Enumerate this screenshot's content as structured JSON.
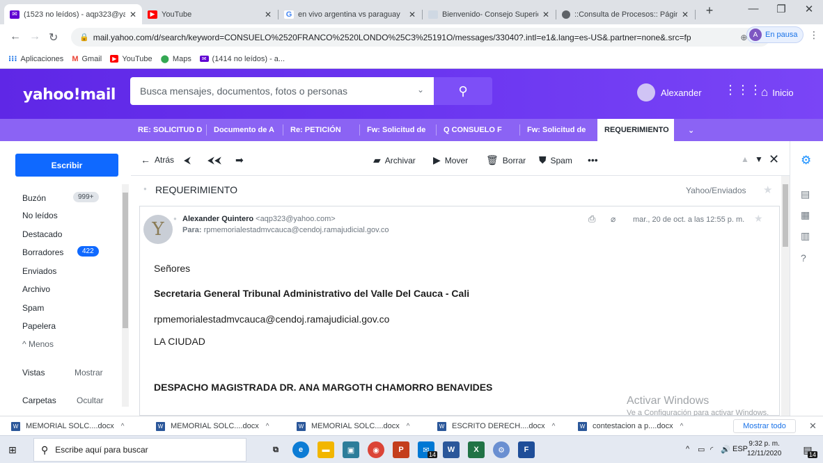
{
  "browser": {
    "tabs": [
      {
        "label": "(1523 no leídos) - aqp323@ya",
        "icon": "yahoo-mail-icon",
        "active": true
      },
      {
        "label": "YouTube",
        "icon": "youtube-icon",
        "active": false
      },
      {
        "label": "en vivo argentina vs paraguay",
        "icon": "google-icon",
        "active": false
      },
      {
        "label": "Bienvenido- Consejo Superior",
        "icon": "page-icon",
        "active": false
      },
      {
        "label": "::Consulta de Procesos:: Págin",
        "icon": "globe-icon",
        "active": false
      }
    ],
    "url": "mail.yahoo.com/d/search/keyword=CONSUELO%2520FRANCO%2520LONDO%25C3%25191O/messages/33040?.intl=e1&.lang=es-US&.partner=none&.src=fp",
    "profile_initial": "A",
    "profile_label": "En pausa",
    "bookmarks": [
      {
        "label": "Aplicaciones",
        "icon": "apps-grid-icon"
      },
      {
        "label": "Gmail",
        "icon": "gmail-icon"
      },
      {
        "label": "YouTube",
        "icon": "youtube-icon"
      },
      {
        "label": "Maps",
        "icon": "maps-pin-icon"
      },
      {
        "label": "(1414 no leídos) - a...",
        "icon": "yahoo-mail-icon"
      }
    ]
  },
  "yahoo": {
    "logo": "yahoo!mail",
    "search_placeholder": "Busca mensajes, documentos, fotos o personas",
    "user_name": "Alexander",
    "home_label": "Inicio",
    "mail_tabs": [
      {
        "label": "RE: SOLICITUD D",
        "active": false
      },
      {
        "label": "Documento de A",
        "active": false
      },
      {
        "label": "Re: PETICIÓN",
        "active": false
      },
      {
        "label": "Fw: Solicitud de",
        "active": false
      },
      {
        "label": "Q  CONSUELO F",
        "active": false
      },
      {
        "label": "Fw: Solicitud de",
        "active": false
      },
      {
        "label": "REQUERIMIENTO",
        "active": true
      }
    ],
    "compose_label": "Escribir",
    "folders": [
      {
        "label": "Buzón",
        "badge": "999+",
        "badge_style": "grey"
      },
      {
        "label": "No leídos",
        "badge": "",
        "badge_style": ""
      },
      {
        "label": "Destacado",
        "badge": "",
        "badge_style": ""
      },
      {
        "label": "Borradores",
        "badge": "422",
        "badge_style": "blue"
      },
      {
        "label": "Enviados",
        "badge": "",
        "badge_style": ""
      },
      {
        "label": "Archivo",
        "badge": "",
        "badge_style": ""
      },
      {
        "label": "Spam",
        "badge": "",
        "badge_style": ""
      },
      {
        "label": "Papelera",
        "badge": "",
        "badge_style": ""
      }
    ],
    "less_label": "^ Menos",
    "views_label": "Vistas",
    "views_action": "Mostrar",
    "folders_label": "Carpetas",
    "folders_action": "Ocultar",
    "toolbar": {
      "back": "Atrás",
      "archive": "Archivar",
      "move": "Mover",
      "delete": "Borrar",
      "spam": "Spam"
    },
    "message": {
      "subject": "REQUERIMIENTO",
      "folder_tag": "Yahoo/Enviados",
      "sender_name": "Alexander Quintero",
      "sender_email": "<aqp323@yahoo.com>",
      "to_label": "Para:",
      "to_address": "rpmemorialestadmvcauca@cendoj.ramajudicial.gov.co",
      "date": "mar., 20 de oct. a las 12:55 p. m.",
      "body": [
        {
          "text": "Señores",
          "bold": false
        },
        {
          "text": "Secretaria General Tribunal Administrativo del Valle Del Cauca - Cali",
          "bold": true
        },
        {
          "text": "rpmemorialestadmvcauca@cendoj.ramajudicial.gov.co",
          "bold": false
        },
        {
          "text": "LA CIUDAD",
          "bold": false
        },
        {
          "text": "DESPACHO MAGISTRADA DR. ANA MARGOTH CHAMORRO BENAVIDES",
          "bold": true
        }
      ]
    }
  },
  "downloads": {
    "items": [
      "MEMORIAL SOLC....docx",
      "MEMORIAL SOLC....docx",
      "MEMORIAL SOLC....docx",
      "ESCRITO DERECH....docx",
      "contestacion a p....docx"
    ],
    "show_all": "Mostrar todo"
  },
  "watermark": {
    "title": "Activar Windows",
    "subtitle": "Ve a Configuración para activar Windows."
  },
  "taskbar": {
    "search_placeholder": "Escribe aquí para buscar",
    "lang": "ESP",
    "time": "9:32 p. m.",
    "date": "12/11/2020",
    "mail_badge": "14",
    "notif_badge": "14"
  }
}
